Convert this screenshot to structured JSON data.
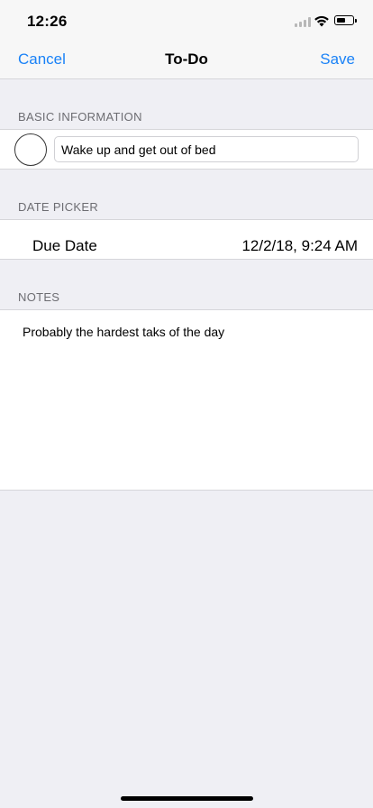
{
  "status_bar": {
    "time": "12:26"
  },
  "nav": {
    "cancel_label": "Cancel",
    "title": "To-Do",
    "save_label": "Save",
    "accent_color": "#1a82f7"
  },
  "sections": {
    "basic_info": {
      "header": "BASIC INFORMATION",
      "title_value": "Wake up and get out of bed"
    },
    "date_picker": {
      "header": "DATE PICKER",
      "due_label": "Due Date",
      "due_value": "12/2/18, 9:24 AM"
    },
    "notes": {
      "header": "NOTES",
      "text": "Probably the hardest taks of the day"
    }
  }
}
